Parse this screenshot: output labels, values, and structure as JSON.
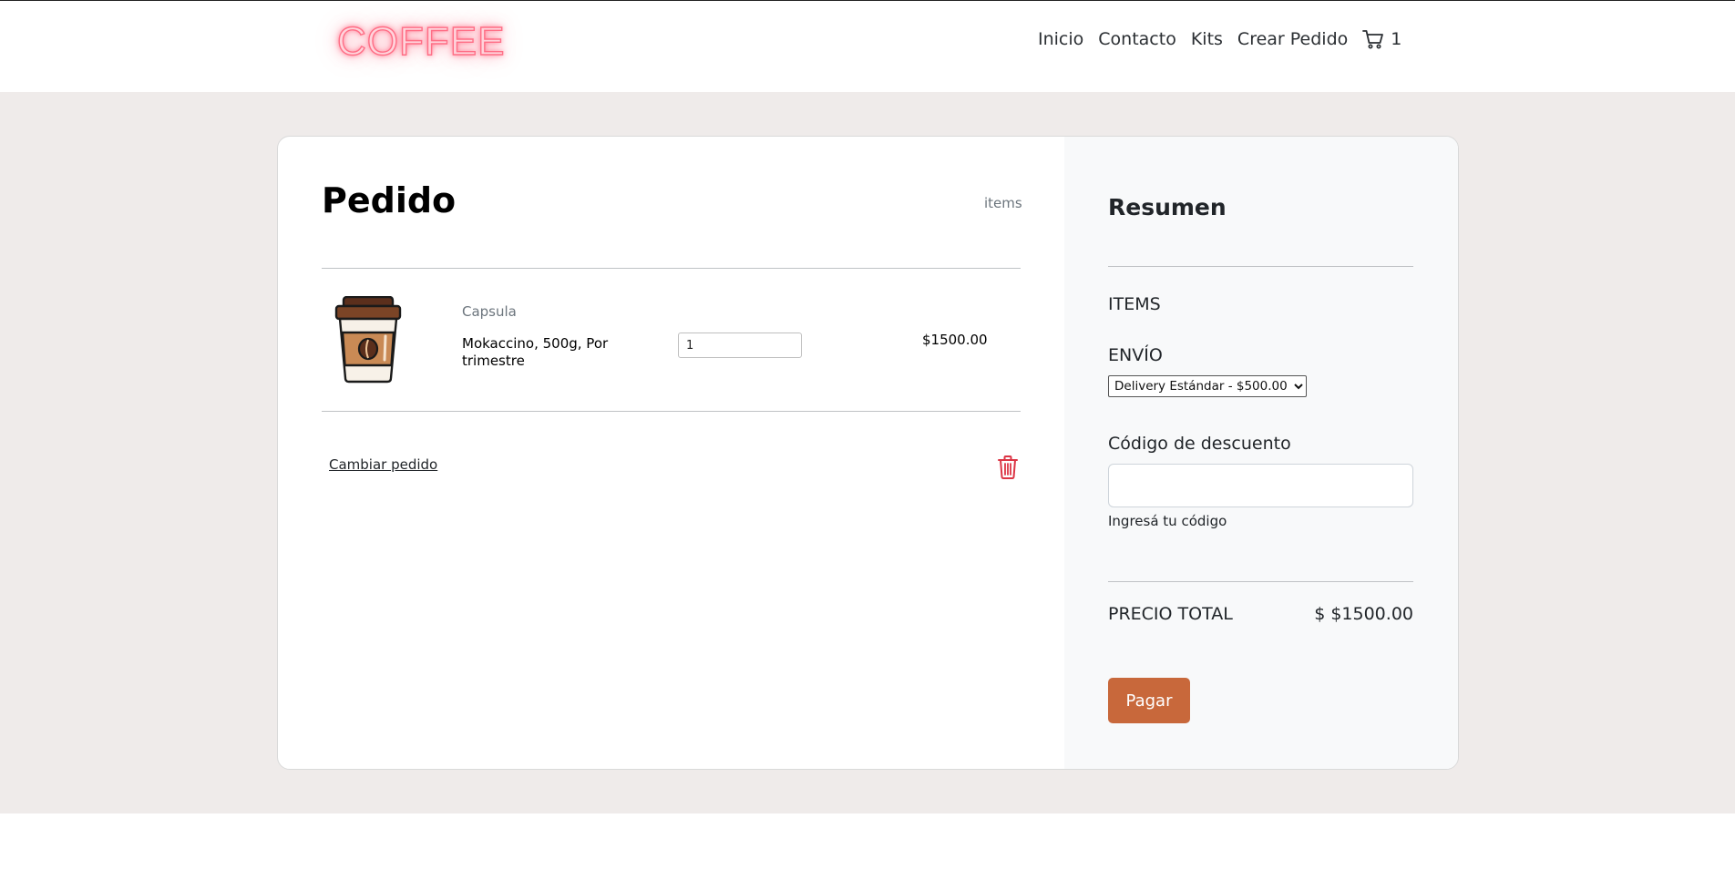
{
  "brand": {
    "logo_text": "COFFEE"
  },
  "nav": {
    "items": [
      {
        "label": "Inicio"
      },
      {
        "label": "Contacto"
      },
      {
        "label": "Kits"
      },
      {
        "label": "Crear Pedido"
      }
    ],
    "cart_count": "1",
    "cart_icon": "cart-icon"
  },
  "order": {
    "title": "Pedido",
    "items_label": "items",
    "product": {
      "image_icon": "coffee-cup-icon",
      "category": "Capsula",
      "name": "Mokaccino, 500g, Por trimestre",
      "quantity": "1",
      "price": "$1500.00"
    },
    "change_link": "Cambiar pedido",
    "delete_icon": "trash-icon"
  },
  "summary": {
    "title": "Resumen",
    "items_label": "ITEMS",
    "shipping_label": "ENVÍO",
    "shipping_selected": "Delivery Estándar - $500.00",
    "discount_label": "Código de descuento",
    "discount_help": "Ingresá tu código",
    "total_label": "PRECIO TOTAL",
    "total_value": "$ $1500.00",
    "pay_button": "Pagar"
  },
  "colors": {
    "accent": "#c8683b",
    "page_band": "#efebea",
    "summary_bg": "#f8f9fa",
    "logo_neon": "#ff6f86",
    "trash": "#dc3545"
  }
}
